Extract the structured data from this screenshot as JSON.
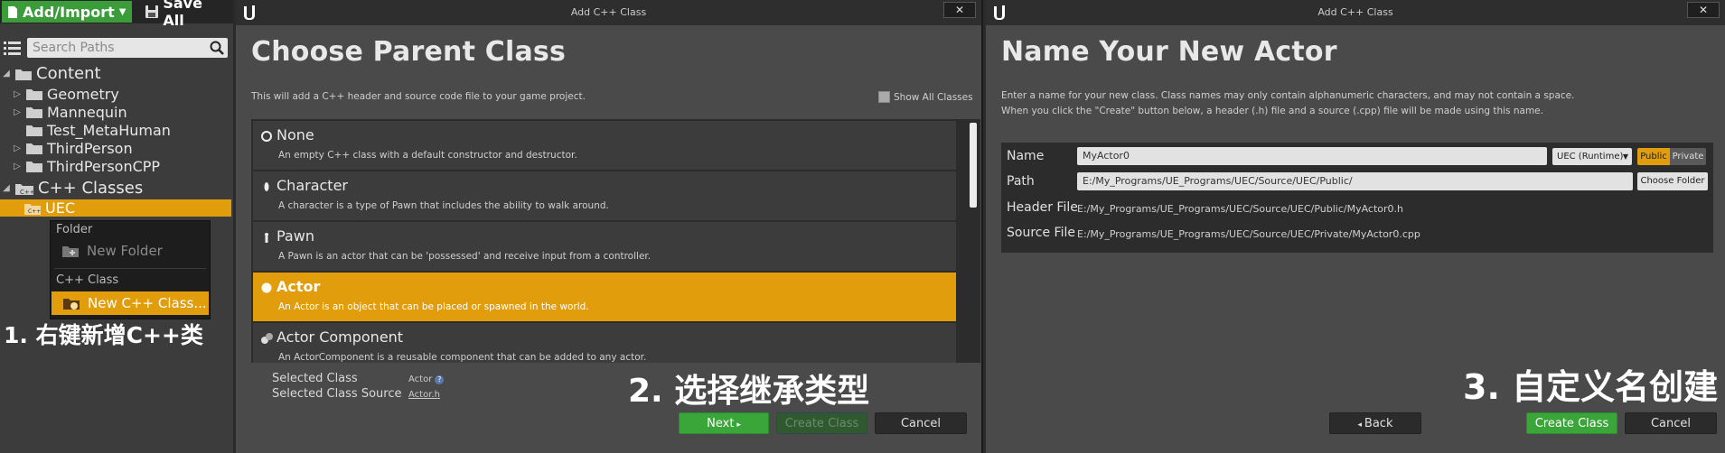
{
  "left_panel": {
    "add_import": "Add/Import",
    "save_all": "Save All",
    "search_placeholder": "Search Paths",
    "tree": {
      "content": "Content",
      "items": [
        "Geometry",
        "Mannequin",
        "Test_MetaHuman",
        "ThirdPerson",
        "ThirdPersonCPP"
      ],
      "cpp_classes": "C++ Classes",
      "uec": "UEC"
    },
    "context_menu": {
      "folder_header": "Folder",
      "new_folder": "New Folder",
      "cpp_header": "C++ Class",
      "new_cpp_class": "New C++ Class..."
    },
    "caption": "1. 右键新增C++类"
  },
  "dialog1": {
    "window_title": "Add C++ Class",
    "close": "✕",
    "heading": "Choose Parent Class",
    "description": "This will add a C++ header and source code file to your game project.",
    "show_all": "Show All Classes",
    "classes": [
      {
        "name": "None",
        "desc": "An empty C++ class with a default constructor and destructor."
      },
      {
        "name": "Character",
        "desc": "A character is a type of Pawn that includes the ability to walk around."
      },
      {
        "name": "Pawn",
        "desc": "A Pawn is an actor that can be 'possessed' and receive input from a controller."
      },
      {
        "name": "Actor",
        "desc": "An Actor is an object that can be placed or spawned in the world."
      },
      {
        "name": "Actor Component",
        "desc": "An ActorComponent is a reusable component that can be added to any actor."
      }
    ],
    "selected_class_label": "Selected Class",
    "selected_class_value": "Actor",
    "selected_source_label": "Selected Class Source",
    "selected_source_value": "Actor.h",
    "caption": "2. 选择继承类型",
    "next": "Next",
    "create_class": "Create Class",
    "cancel": "Cancel"
  },
  "dialog2": {
    "window_title": "Add C++ Class",
    "close": "✕",
    "heading": "Name Your New Actor",
    "description_line1": "Enter a name for your new class. Class names may only contain alphanumeric characters, and may not contain a space.",
    "description_line2": "When you click the \"Create\" button below, a header (.h) file and a source (.cpp) file will be made using this name.",
    "name_label": "Name",
    "name_value": "MyActor0",
    "module": "UEC (Runtime)",
    "public": "Public",
    "private": "Private",
    "path_label": "Path",
    "path_value": "E:/My_Programs/UE_Programs/UEC/Source/UEC/Public/",
    "choose_folder": "Choose Folder",
    "header_label": "Header File",
    "header_value": "E:/My_Programs/UE_Programs/UEC/Source/UEC/Public/MyActor0.h",
    "source_label": "Source File",
    "source_value": "E:/My_Programs/UE_Programs/UEC/Source/UEC/Private/MyActor0.cpp",
    "caption": "3. 自定义名创建",
    "back": "Back",
    "create_class": "Create Class",
    "cancel": "Cancel"
  },
  "colors": {
    "accent": "#e29d0c",
    "green": "#3aa63a"
  }
}
